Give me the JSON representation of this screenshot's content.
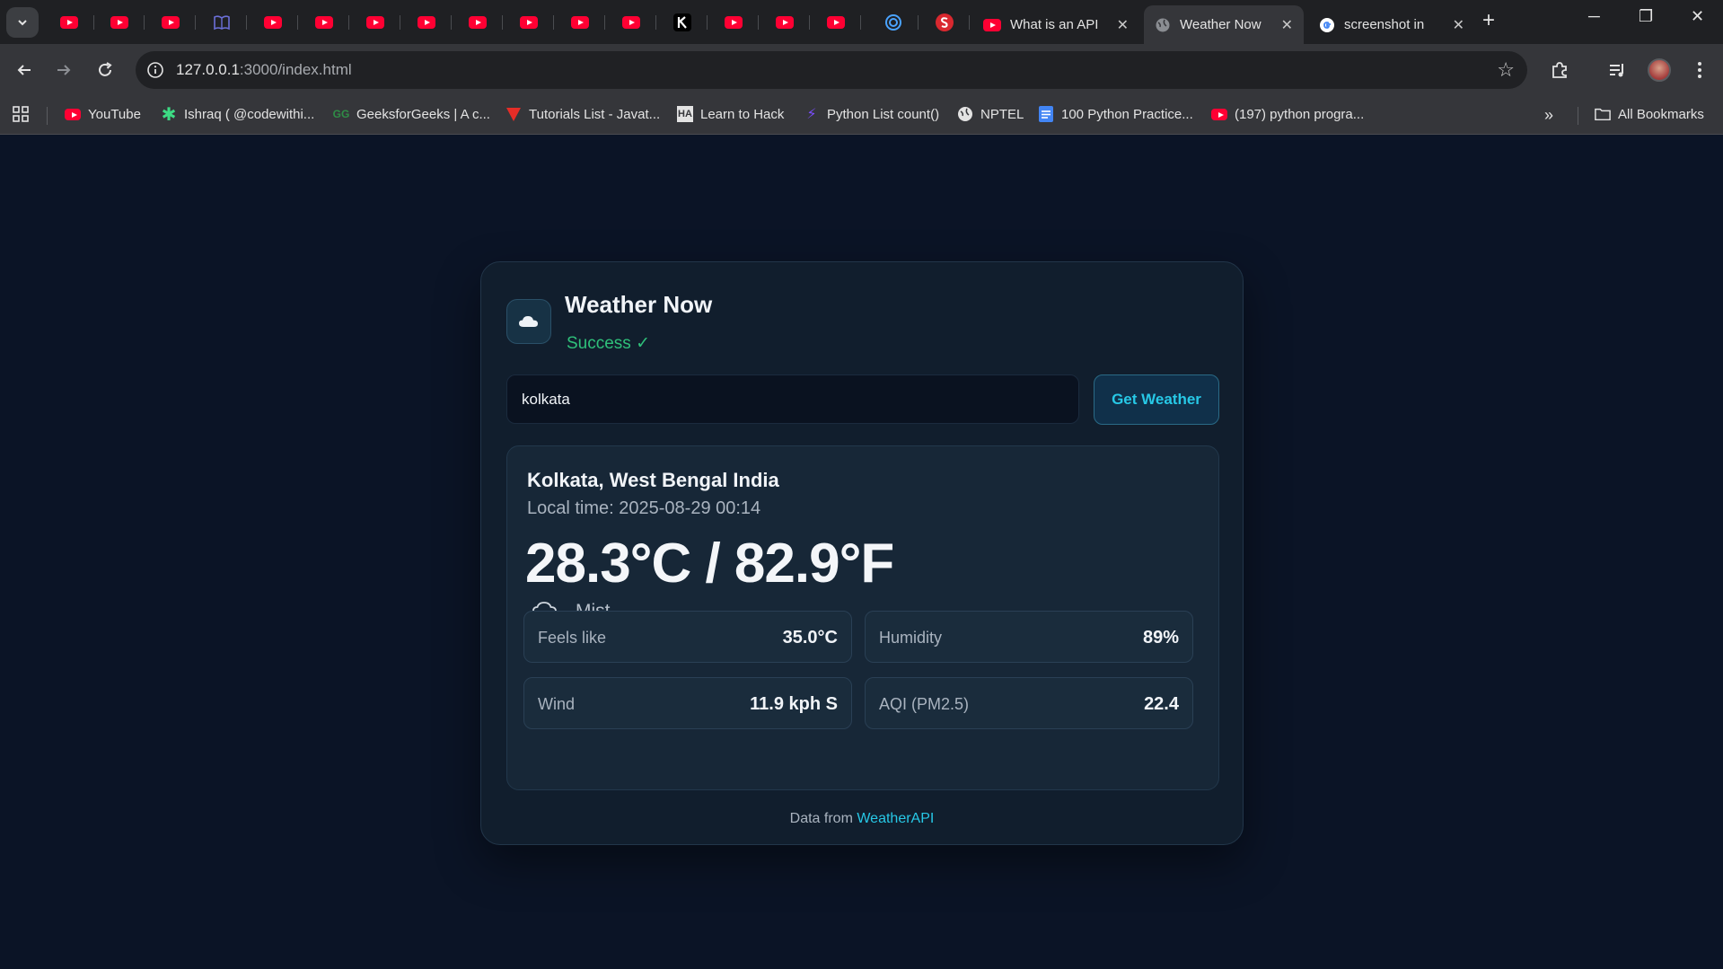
{
  "browser": {
    "tabs": [
      {
        "label": "What is an API",
        "icon": "youtube-icon"
      },
      {
        "label": "Weather Now",
        "icon": "globe-icon",
        "active": true
      },
      {
        "label": "screenshot in",
        "icon": "google-icon"
      }
    ],
    "url_host": "127.0.0.1",
    "url_path": ":3000/index.html",
    "bookmarks": [
      {
        "label": "YouTube",
        "icon": "youtube-icon"
      },
      {
        "label": "Ishraq ( @codewithi...",
        "icon": "asterisk-icon"
      },
      {
        "label": "GeeksforGeeks | A c...",
        "icon": "gfg-icon"
      },
      {
        "label": "Tutorials List - Javat...",
        "icon": "javatpoint-icon"
      },
      {
        "label": "Learn to Hack",
        "icon": "htb-icon"
      },
      {
        "label": "Python List count()",
        "icon": "python-icon"
      },
      {
        "label": "NPTEL",
        "icon": "globe-icon"
      },
      {
        "label": "100 Python Practice...",
        "icon": "docs-icon"
      },
      {
        "label": "(197) python progra...",
        "icon": "youtube-icon"
      }
    ],
    "all_bookmarks": "All Bookmarks"
  },
  "app": {
    "title": "Weather Now",
    "status": "Success ✓",
    "search_value": "kolkata",
    "button": "Get Weather",
    "location": "Kolkata, West Bengal India",
    "local_time": "Local time: 2025-08-29 00:14",
    "temperature": "28.3°C / 82.9°F",
    "condition": "Mist",
    "stats": {
      "feels_like_label": "Feels like",
      "feels_like_value": "35.0°C",
      "humidity_label": "Humidity",
      "humidity_value": "89%",
      "wind_label": "Wind",
      "wind_value": "11.9 kph S",
      "aqi_label": "AQI (PM2.5)",
      "aqi_value": "22.4"
    },
    "footer_prefix": "Data from",
    "footer_link": "WeatherAPI"
  },
  "colors": {
    "page_bg": "#0b1426",
    "accent": "#27c8e6",
    "success": "#2fc07a"
  }
}
